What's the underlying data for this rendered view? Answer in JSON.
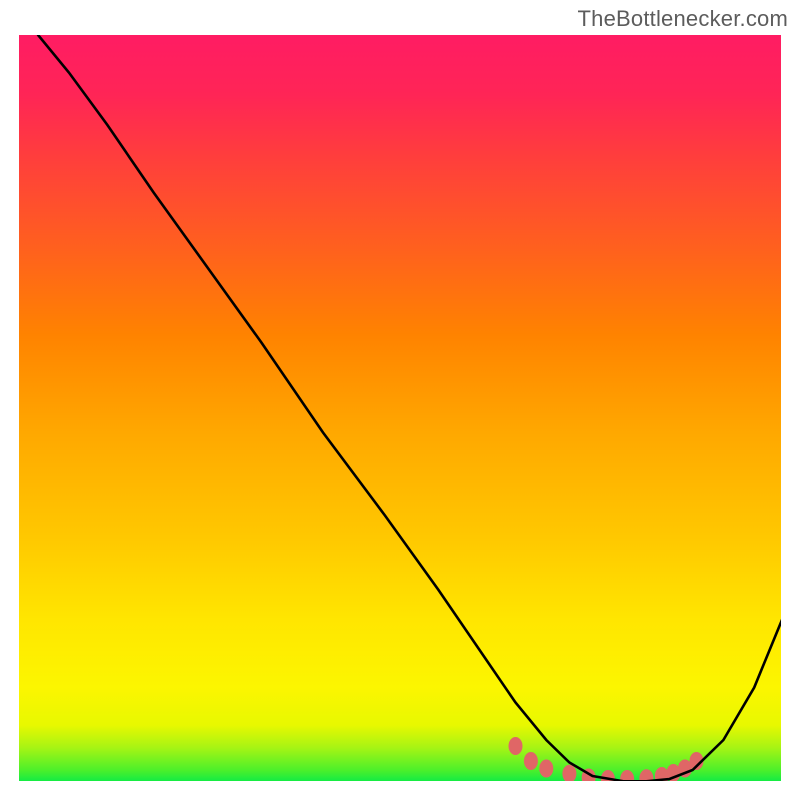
{
  "attribution": "TheBottlenecker.com",
  "chart_data": {
    "type": "line",
    "title": "",
    "xlabel": "",
    "ylabel": "",
    "xlim": [
      0,
      100
    ],
    "ylim": [
      0,
      100
    ],
    "series": [
      {
        "name": "bottleneck-curve",
        "color": "#000000",
        "x": [
          3,
          7,
          12,
          18,
          25,
          32,
          40,
          48,
          55,
          61,
          65,
          69,
          72,
          75,
          79,
          82,
          85,
          88,
          92,
          96,
          100
        ],
        "y": [
          100,
          95,
          88,
          79,
          69,
          59,
          47,
          36,
          26,
          17,
          11,
          6,
          3,
          1.2,
          0.5,
          0.5,
          0.8,
          2,
          6,
          13,
          23
        ]
      }
    ],
    "markers": {
      "name": "highlight-points",
      "color": "#e06666",
      "x": [
        65,
        67,
        69,
        72,
        74.5,
        77,
        79.5,
        82,
        84,
        85.5,
        87,
        88.5
      ],
      "y": [
        5.2,
        3.2,
        2.2,
        1.5,
        1.0,
        0.8,
        0.8,
        0.9,
        1.2,
        1.6,
        2.2,
        3.2
      ]
    }
  },
  "gradient": {
    "top": "#ff1c63",
    "mid_hi": "#ff6a15",
    "mid": "#ffd400",
    "mid_lo": "#eef800",
    "bottom": "#00ea4d"
  }
}
